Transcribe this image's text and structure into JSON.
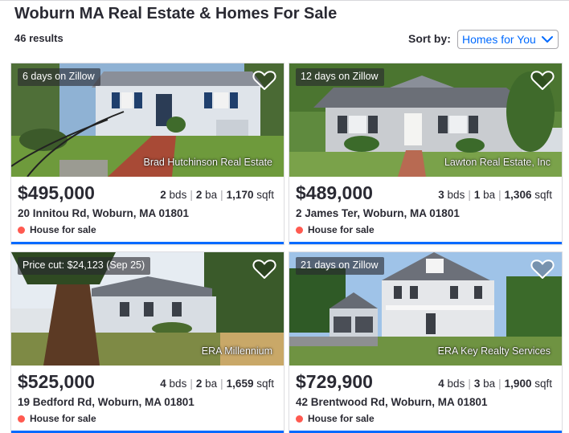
{
  "page": {
    "title": "Woburn MA Real Estate & Homes For Sale",
    "results_count": "46 results",
    "sort_label": "Sort by:",
    "sort_value": "Homes for You"
  },
  "colors": {
    "accent": "#006aff",
    "status_dot": "#ff5a50",
    "text": "#2a2a33"
  },
  "listings": [
    {
      "badge": "6 days on Zillow",
      "brokerage": "Brad Hutchinson Real Estate",
      "price": "$495,000",
      "beds": "2",
      "beds_unit": "bds",
      "baths": "2",
      "baths_unit": "ba",
      "sqft": "1,170",
      "sqft_unit": "sqft",
      "address": "20 Innitou Rd, Woburn, MA 01801",
      "status": "House for sale"
    },
    {
      "badge": "12 days on Zillow",
      "brokerage": "Lawton Real Estate, Inc",
      "price": "$489,000",
      "beds": "3",
      "beds_unit": "bds",
      "baths": "1",
      "baths_unit": "ba",
      "sqft": "1,306",
      "sqft_unit": "sqft",
      "address": "2 James Ter, Woburn, MA 01801",
      "status": "House for sale"
    },
    {
      "badge": "Price cut: $24,123 (Sep 25)",
      "brokerage": "ERA Millennium",
      "price": "$525,000",
      "beds": "4",
      "beds_unit": "bds",
      "baths": "2",
      "baths_unit": "ba",
      "sqft": "1,659",
      "sqft_unit": "sqft",
      "address": "19 Bedford Rd, Woburn, MA 01801",
      "status": "House for sale"
    },
    {
      "badge": "21 days on Zillow",
      "brokerage": "ERA Key Realty Services",
      "price": "$729,900",
      "beds": "4",
      "beds_unit": "bds",
      "baths": "3",
      "baths_unit": "ba",
      "sqft": "1,900",
      "sqft_unit": "sqft",
      "address": "42 Brentwood Rd, Woburn, MA 01801",
      "status": "House for sale"
    }
  ]
}
